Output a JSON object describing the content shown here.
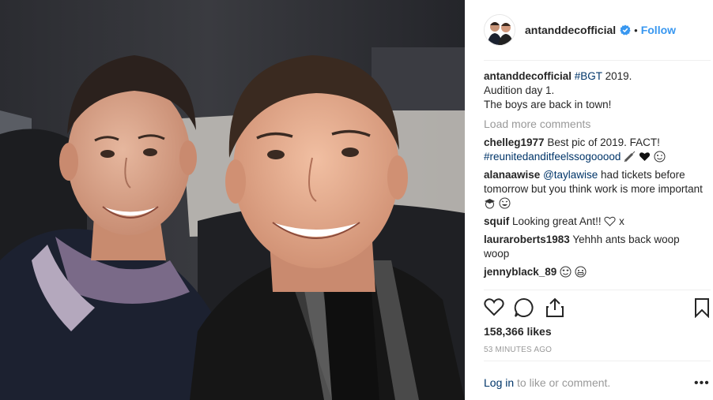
{
  "post": {
    "username": "antanddecofficial",
    "follow_label": "Follow",
    "dot": "•",
    "verified_icon": "verified-badge",
    "caption": {
      "user": "antanddecofficial",
      "hashtag": "#BGT",
      "line1_rest": " 2019.",
      "line2": "Audition day 1.",
      "line3": "The boys are back in town!"
    },
    "load_more": "Load more comments",
    "comments": [
      {
        "user": "chelleg1977",
        "text": " Best pic of 2019. FACT!",
        "tag": "#reunitedanditfeelssogooood"
      },
      {
        "user": "alanaawise",
        "tag": "@taylawise",
        "text": " had tickets before tomorrow but you think work is more important"
      },
      {
        "user": "squif",
        "text": " Looking great Ant!!",
        "suffix": " x"
      },
      {
        "user": "lauraroberts1983",
        "text": " Yehhh ants back woop woop"
      },
      {
        "user": "jennyblack_89",
        "text": ""
      }
    ],
    "likes": "158,366 likes",
    "time": "53 MINUTES AGO",
    "login_link": "Log in",
    "login_rest": " to like or comment.",
    "more_label": "•••"
  },
  "colors": {
    "link_blue": "#3897f0",
    "hashtag": "#003569",
    "muted": "#999999"
  }
}
